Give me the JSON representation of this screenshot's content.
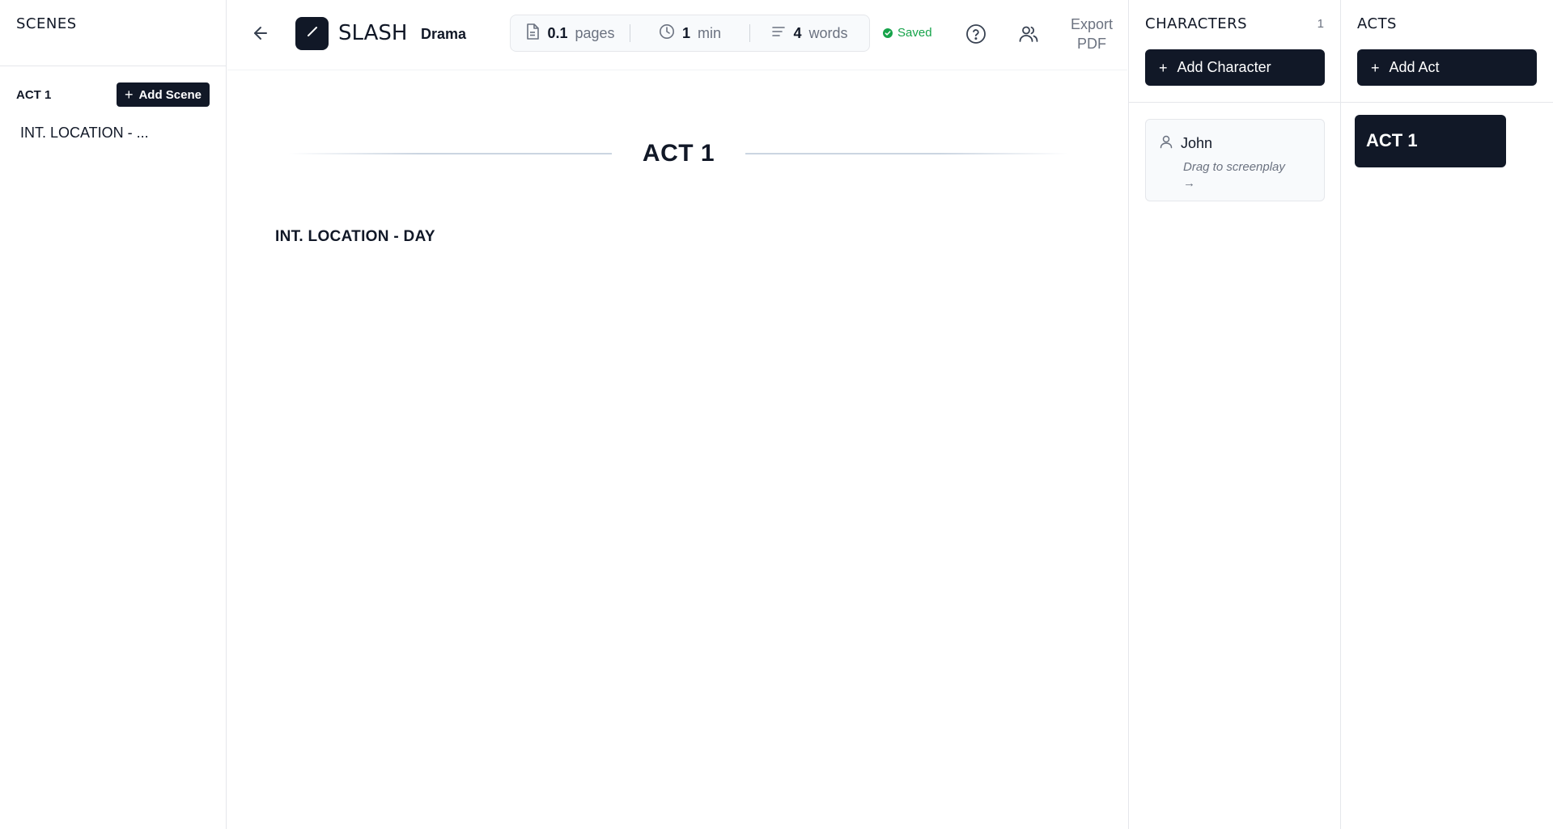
{
  "scenes_panel": {
    "title": "SCENES",
    "act_label": "ACT 1",
    "add_scene_label": "Add Scene",
    "items": [
      {
        "label": "INT. LOCATION - ..."
      }
    ]
  },
  "topbar": {
    "logo_text": "SLASH",
    "genre": "Drama",
    "stats": {
      "pages_value": "0.1",
      "pages_label": "pages",
      "minutes_value": "1",
      "minutes_label": "min",
      "words_value": "4",
      "words_label": "words"
    },
    "status": "Saved",
    "export_label_line1": "Export",
    "export_label_line2": "PDF"
  },
  "editor": {
    "act_heading": "ACT 1",
    "scene_heading": "INT. LOCATION - DAY"
  },
  "characters_panel": {
    "title": "CHARACTERS",
    "count": "1",
    "add_label": "Add Character",
    "characters": [
      {
        "name": "John",
        "hint": "Drag to screenplay →"
      }
    ]
  },
  "acts_panel": {
    "title": "ACTS",
    "add_label": "Add Act",
    "acts": [
      {
        "label": "ACT 1"
      }
    ]
  },
  "icons": [
    "arrow-left-icon",
    "pen-slash-icon",
    "document-icon",
    "clock-icon",
    "lines-icon",
    "check-circle-icon",
    "help-circle-icon",
    "users-icon",
    "plus-icon",
    "user-icon"
  ],
  "colors": {
    "primary_dark": "#111827",
    "muted_text": "#6b7280",
    "success": "#16a34a",
    "border": "#e5e7eb",
    "card_bg": "#f8fafc"
  }
}
